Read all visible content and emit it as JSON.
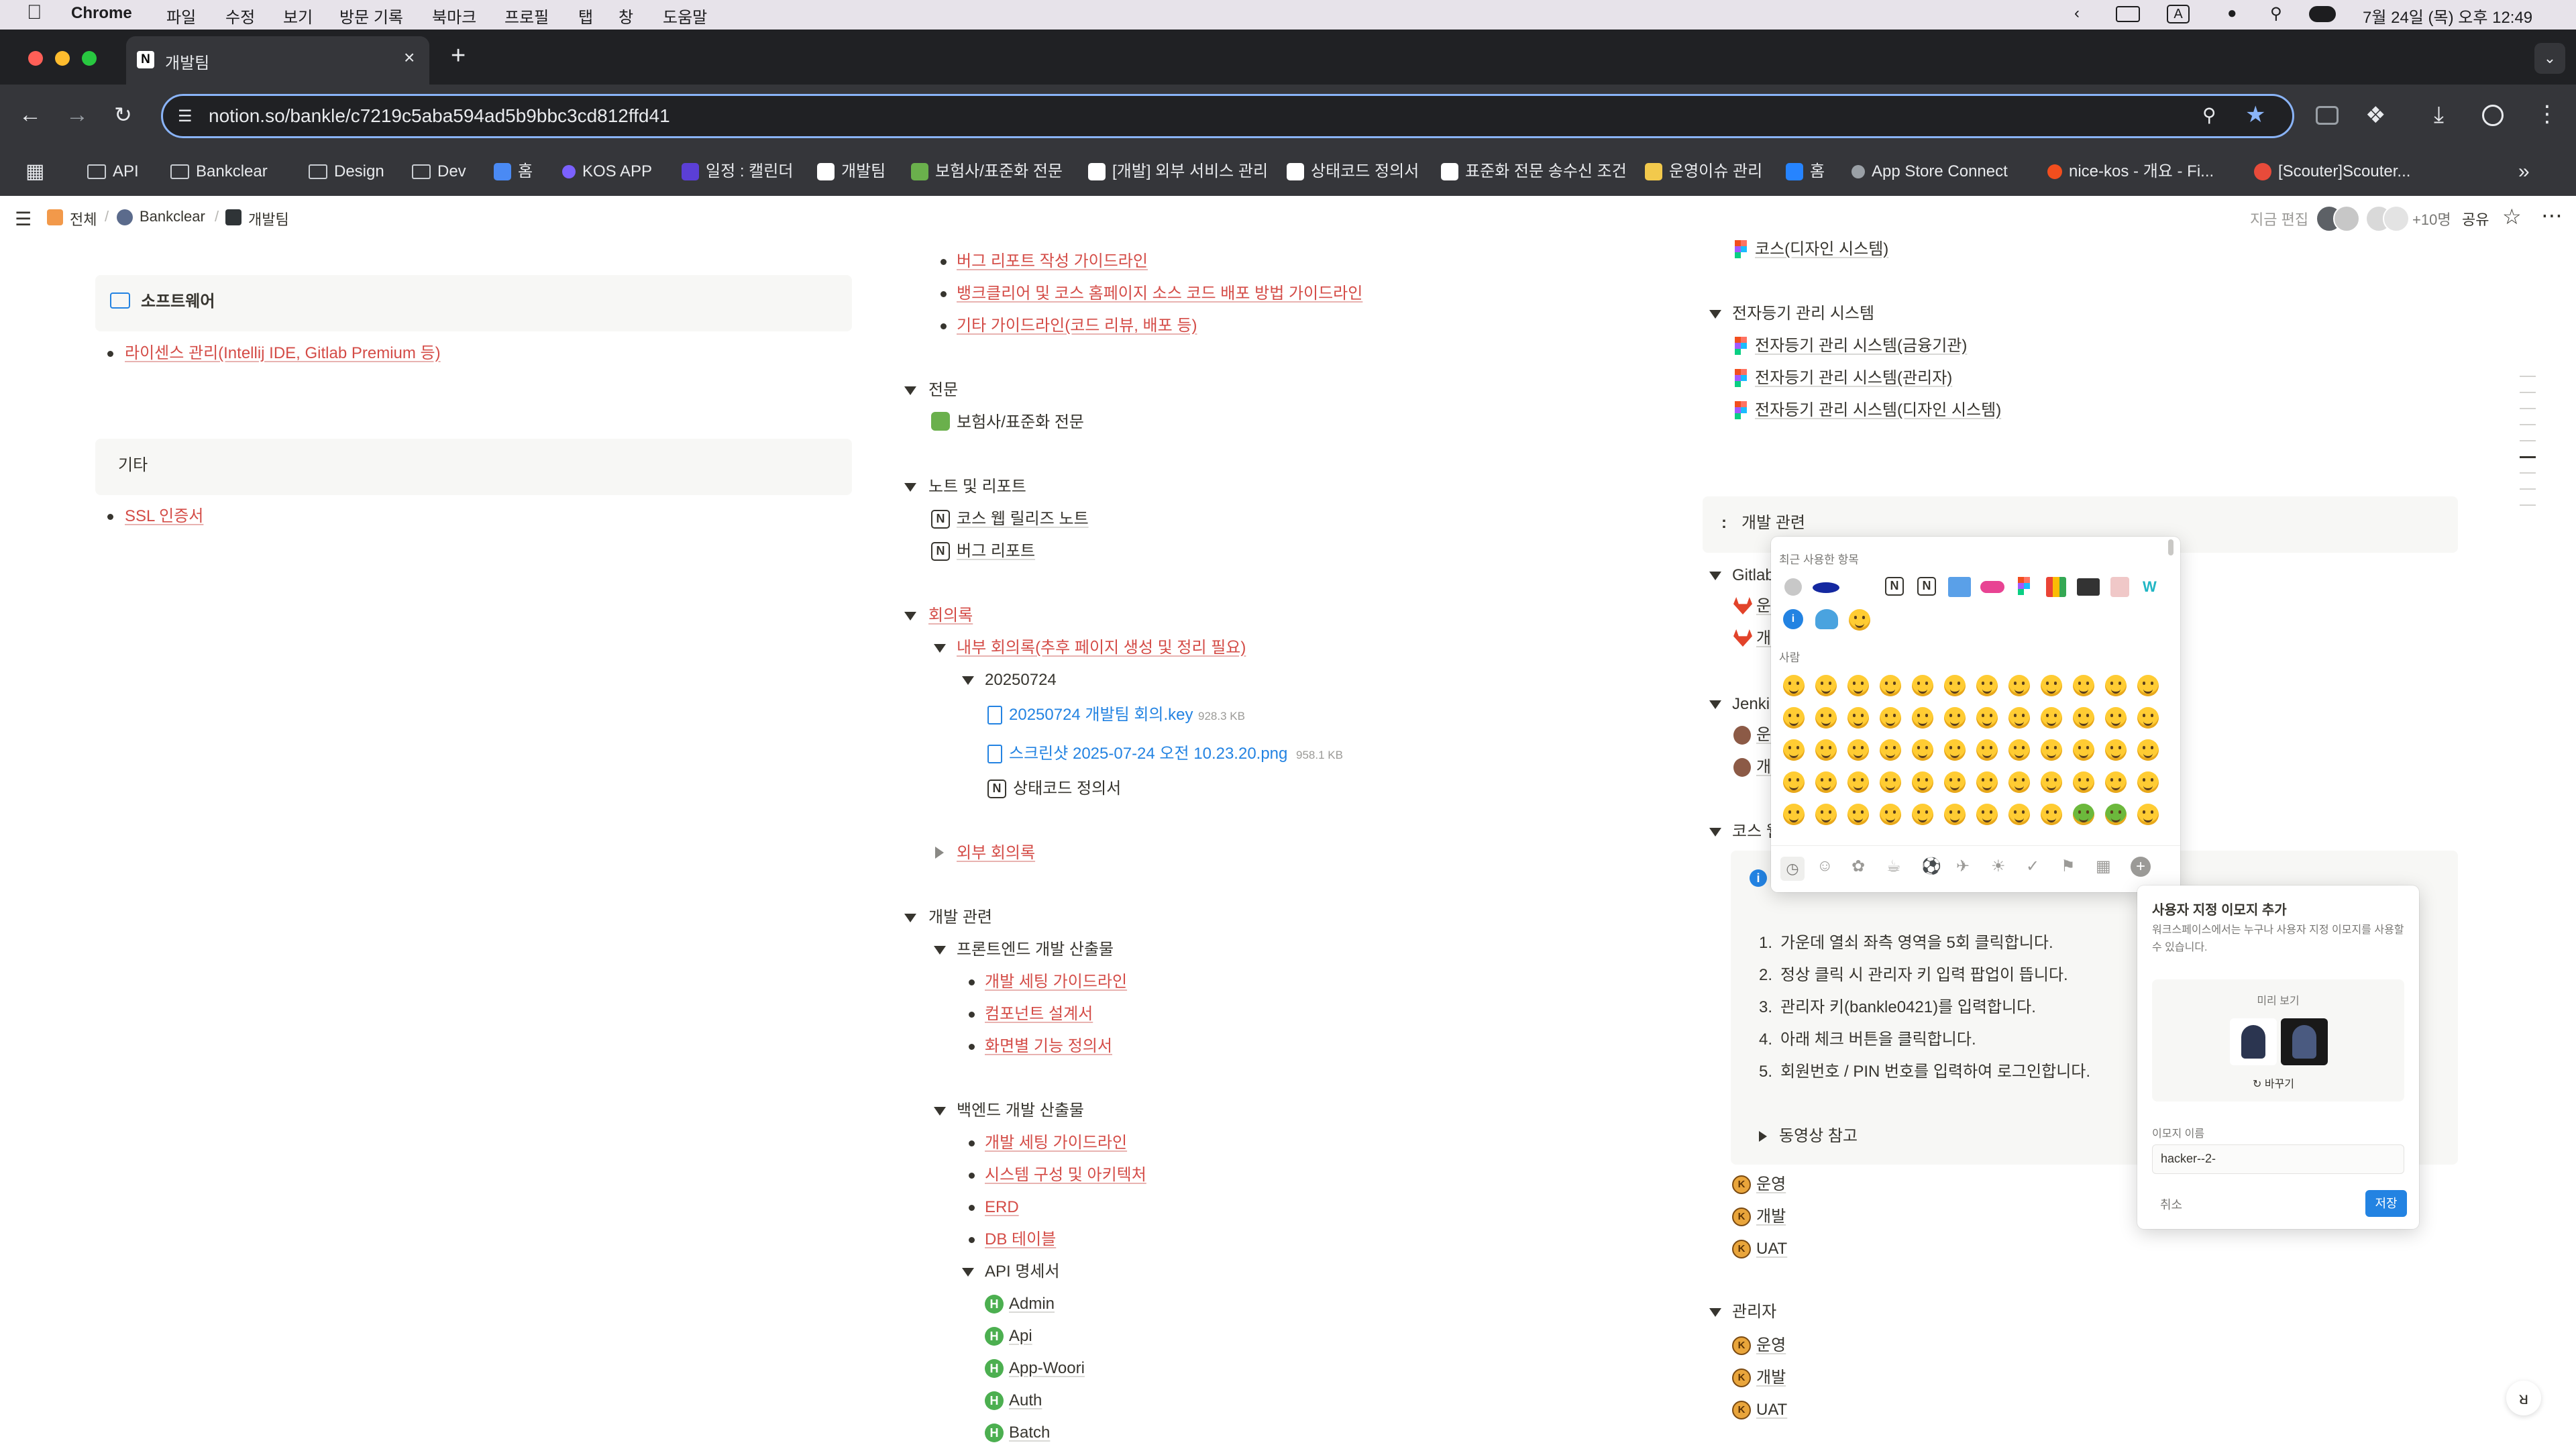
{
  "menubar": {
    "app": "Chrome",
    "menus": [
      "파일",
      "수정",
      "보기",
      "방문 기록",
      "북마크",
      "프로필",
      "탭",
      "창",
      "도움말"
    ],
    "input_indicator": "A",
    "datetime": "7월 24일 (목) 오후 12:49"
  },
  "browser": {
    "tab_title": "개발팀",
    "url": "notion.so/bankle/c7219c5aba594ad5b9bbc3cd812ffd41",
    "bookmarks": [
      "API",
      "Bankclear",
      "Design",
      "Dev",
      "홈",
      "KOS APP",
      "일정 : 캘린더",
      "개발팀",
      "보험사/표준화 전문",
      "[개발] 외부 서비스 관리",
      "상태코드 정의서",
      "표준화 전문 송수신 조건",
      "운영이슈 관리",
      "홈",
      "App Store Connect",
      "nice-kos - 개요 - Fi...",
      "[Scouter]Scouter..."
    ]
  },
  "notion": {
    "breadcrumb": [
      "전체",
      "Bankclear",
      "개발팀"
    ],
    "edited": "지금 편집",
    "presence": "+10명",
    "share": "공유"
  },
  "left": {
    "software_title": "소프트웨어",
    "software_item": "라이센스 관리(Intellij IDE, Gitlab Premium 등)",
    "etc_title": "기타",
    "etc_item": "SSL 인증서"
  },
  "middle": {
    "guides": [
      "버그 리포트 작성 가이드라인",
      "뱅크클리어 및 코스 홈페이지 소스 코드 배포 방법 가이드라인",
      "기타 가이드라인(코드 리뷰, 배포 등)"
    ],
    "spec": "전문",
    "spec_item": "보험사/표준화 전문",
    "notes": "노트 및 리포트",
    "notes_items": [
      "코스 웹 릴리즈 노트",
      "버그 리포트"
    ],
    "minutes": "회의록",
    "internal": "내부 회의록(추후 페이지 생성 및 정리 필요)",
    "date": "20250724",
    "file1": "20250724 개발팀 회의.key",
    "file1_size": "928.3 KB",
    "file2": "스크린샷 2025-07-24 오전 10.23.20.png",
    "file2_size": "958.1 KB",
    "status_page": "상태코드 정의서",
    "external": "외부 회의록",
    "dev": "개발 관련",
    "fe": "프론트엔드 개발 산출물",
    "fe_items": [
      "개발 세팅 가이드라인",
      "컴포넌트 설계서",
      "화면별 기능 정의서"
    ],
    "be": "백엔드 개발 산출물",
    "be_items": [
      "개발 세팅 가이드라인",
      "시스템 구성 및 아키텍처",
      "ERD",
      "DB 테이블"
    ],
    "api": "API 명세서",
    "api_items": [
      "Admin",
      "Api",
      "App-Woori",
      "Auth",
      "Batch"
    ]
  },
  "right": {
    "course_design": "코스(디자인 시스템)",
    "edoc": "전자등기 관리 시스템",
    "edoc_items": [
      "전자등기 관리 시스템(금융기관)",
      "전자등기 관리 시스템(관리자)",
      "전자등기 관리 시스템(디자인 시스템)"
    ],
    "dev_title": "개발 관련",
    "gitlab": "Gitlab",
    "gitlab_items": [
      "운",
      "개"
    ],
    "jenkins": "Jenki",
    "jenkins_items": [
      "운",
      "개"
    ],
    "course_web": "코스 웹",
    "steps": [
      "가운데 열쇠 좌측 영역을 5회 클릭합니다.",
      "정상 클릭 시 관리자 키 입력 팝업이 뜹니다.",
      "관리자 키(bankle0421)를 입력합니다.",
      "아래 체크 버튼을 클릭합니다.",
      "회원번호 / PIN 번호를 입력하여 로그인합니다."
    ],
    "video": "동영상 참고",
    "envs": [
      "운영",
      "개발",
      "UAT"
    ],
    "admin": "관리자",
    "admin_envs": [
      "운영",
      "개발",
      "UAT"
    ]
  },
  "picker": {
    "recent": "최근 사용한 항목",
    "people": "사람"
  },
  "custom_emoji": {
    "title": "사용자 지정 이모지 추가",
    "desc": "워크스페이스에서는 누구나 사용자 지정 이모지를 사용할 수 있습니다.",
    "preview": "미리 보기",
    "replace": "바꾸기",
    "name_label": "이모지 이름",
    "name_value": "hacker--2-",
    "cancel": "취소",
    "save": "저장"
  },
  "colors": {
    "accent": "#2383e2",
    "red_link": "#d44c47",
    "chrome_dark": "#35363a"
  }
}
